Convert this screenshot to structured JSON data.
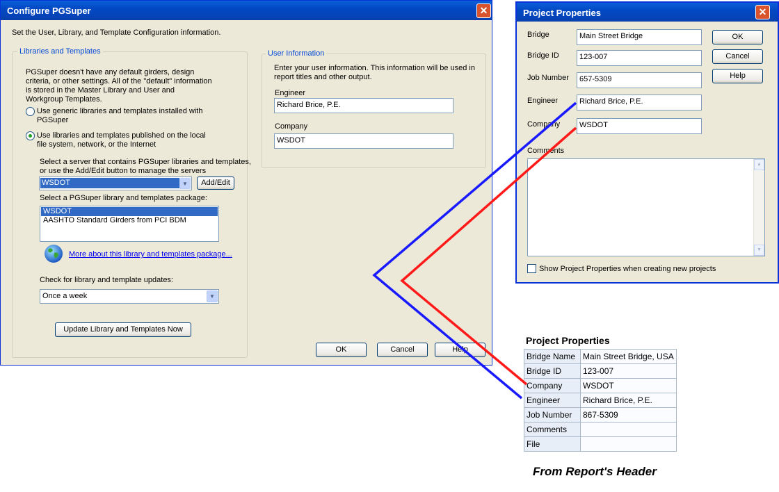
{
  "configure": {
    "title": "Configure PGSuper",
    "description": "Set the User, Library, and Template Configuration information.",
    "libraries_group": "Libraries and Templates",
    "intro": [
      "PGSuper doesn't have any default girders, design",
      "criteria, or other settings. All of the \"default\" information",
      "is stored in the Master Library and User and",
      "Workgroup Templates."
    ],
    "radio_generic": [
      "Use generic libraries and templates installed with",
      "PGSuper"
    ],
    "radio_published": [
      "Use libraries and templates published on the local",
      "file system, network, or the Internet"
    ],
    "server_prompt": [
      "Select a server that contains PGSuper libraries and templates,",
      "or use the Add/Edit button to manage the servers"
    ],
    "server_value": "WSDOT",
    "add_edit_label": "Add/Edit",
    "package_prompt": "Select a PGSuper library and templates package:",
    "packages": [
      "WSDOT",
      "AASHTO Standard Girders from PCI BDM"
    ],
    "more_link": "More about this library and templates package...",
    "updates_prompt": "Check for library and template updates:",
    "updates_value": "Once a week",
    "update_now_label": "Update Library and Templates Now",
    "user_group": "User Information",
    "user_intro": [
      "Enter your user information. This information will be used in",
      "report titles and other output."
    ],
    "engineer_label": "Engineer",
    "engineer_value": "Richard Brice, P.E.",
    "company_label": "Company",
    "company_value": "WSDOT",
    "ok_label": "OK",
    "cancel_label": "Cancel",
    "help_label": "Help"
  },
  "project": {
    "title": "Project Properties",
    "bridge_label": "Bridge",
    "bridge_value": "Main Street Bridge",
    "bridge_id_label": "Bridge ID",
    "bridge_id_value": "123-007",
    "job_label": "Job Number",
    "job_value": "657-5309",
    "engineer_label": "Engineer",
    "engineer_value": "Richard Brice, P.E.",
    "company_label": "Company",
    "company_value": "WSDOT",
    "comments_label": "Comments",
    "show_label": "Show Project Properties when creating new projects",
    "ok_label": "OK",
    "cancel_label": "Cancel",
    "help_label": "Help"
  },
  "report": {
    "title": "Project Properties",
    "rows": [
      {
        "key": "Bridge Name",
        "value": "Main Street Bridge, USA"
      },
      {
        "key": "Bridge ID",
        "value": "123-007"
      },
      {
        "key": "Company",
        "value": "WSDOT"
      },
      {
        "key": "Engineer",
        "value": "Richard Brice, P.E."
      },
      {
        "key": "Job Number",
        "value": "867-5309"
      },
      {
        "key": "Comments",
        "value": ""
      },
      {
        "key": "File",
        "value": ""
      }
    ],
    "caption": "From Report's Header"
  },
  "colors": {
    "engineer_connector": "#1a1aff",
    "company_connector": "#ff1a1a",
    "xp_title_blue": "#0348c4",
    "dialog_face": "#ece9d8"
  },
  "icons": [
    "close-icon",
    "globe-icon",
    "chevron-down-icon"
  ]
}
